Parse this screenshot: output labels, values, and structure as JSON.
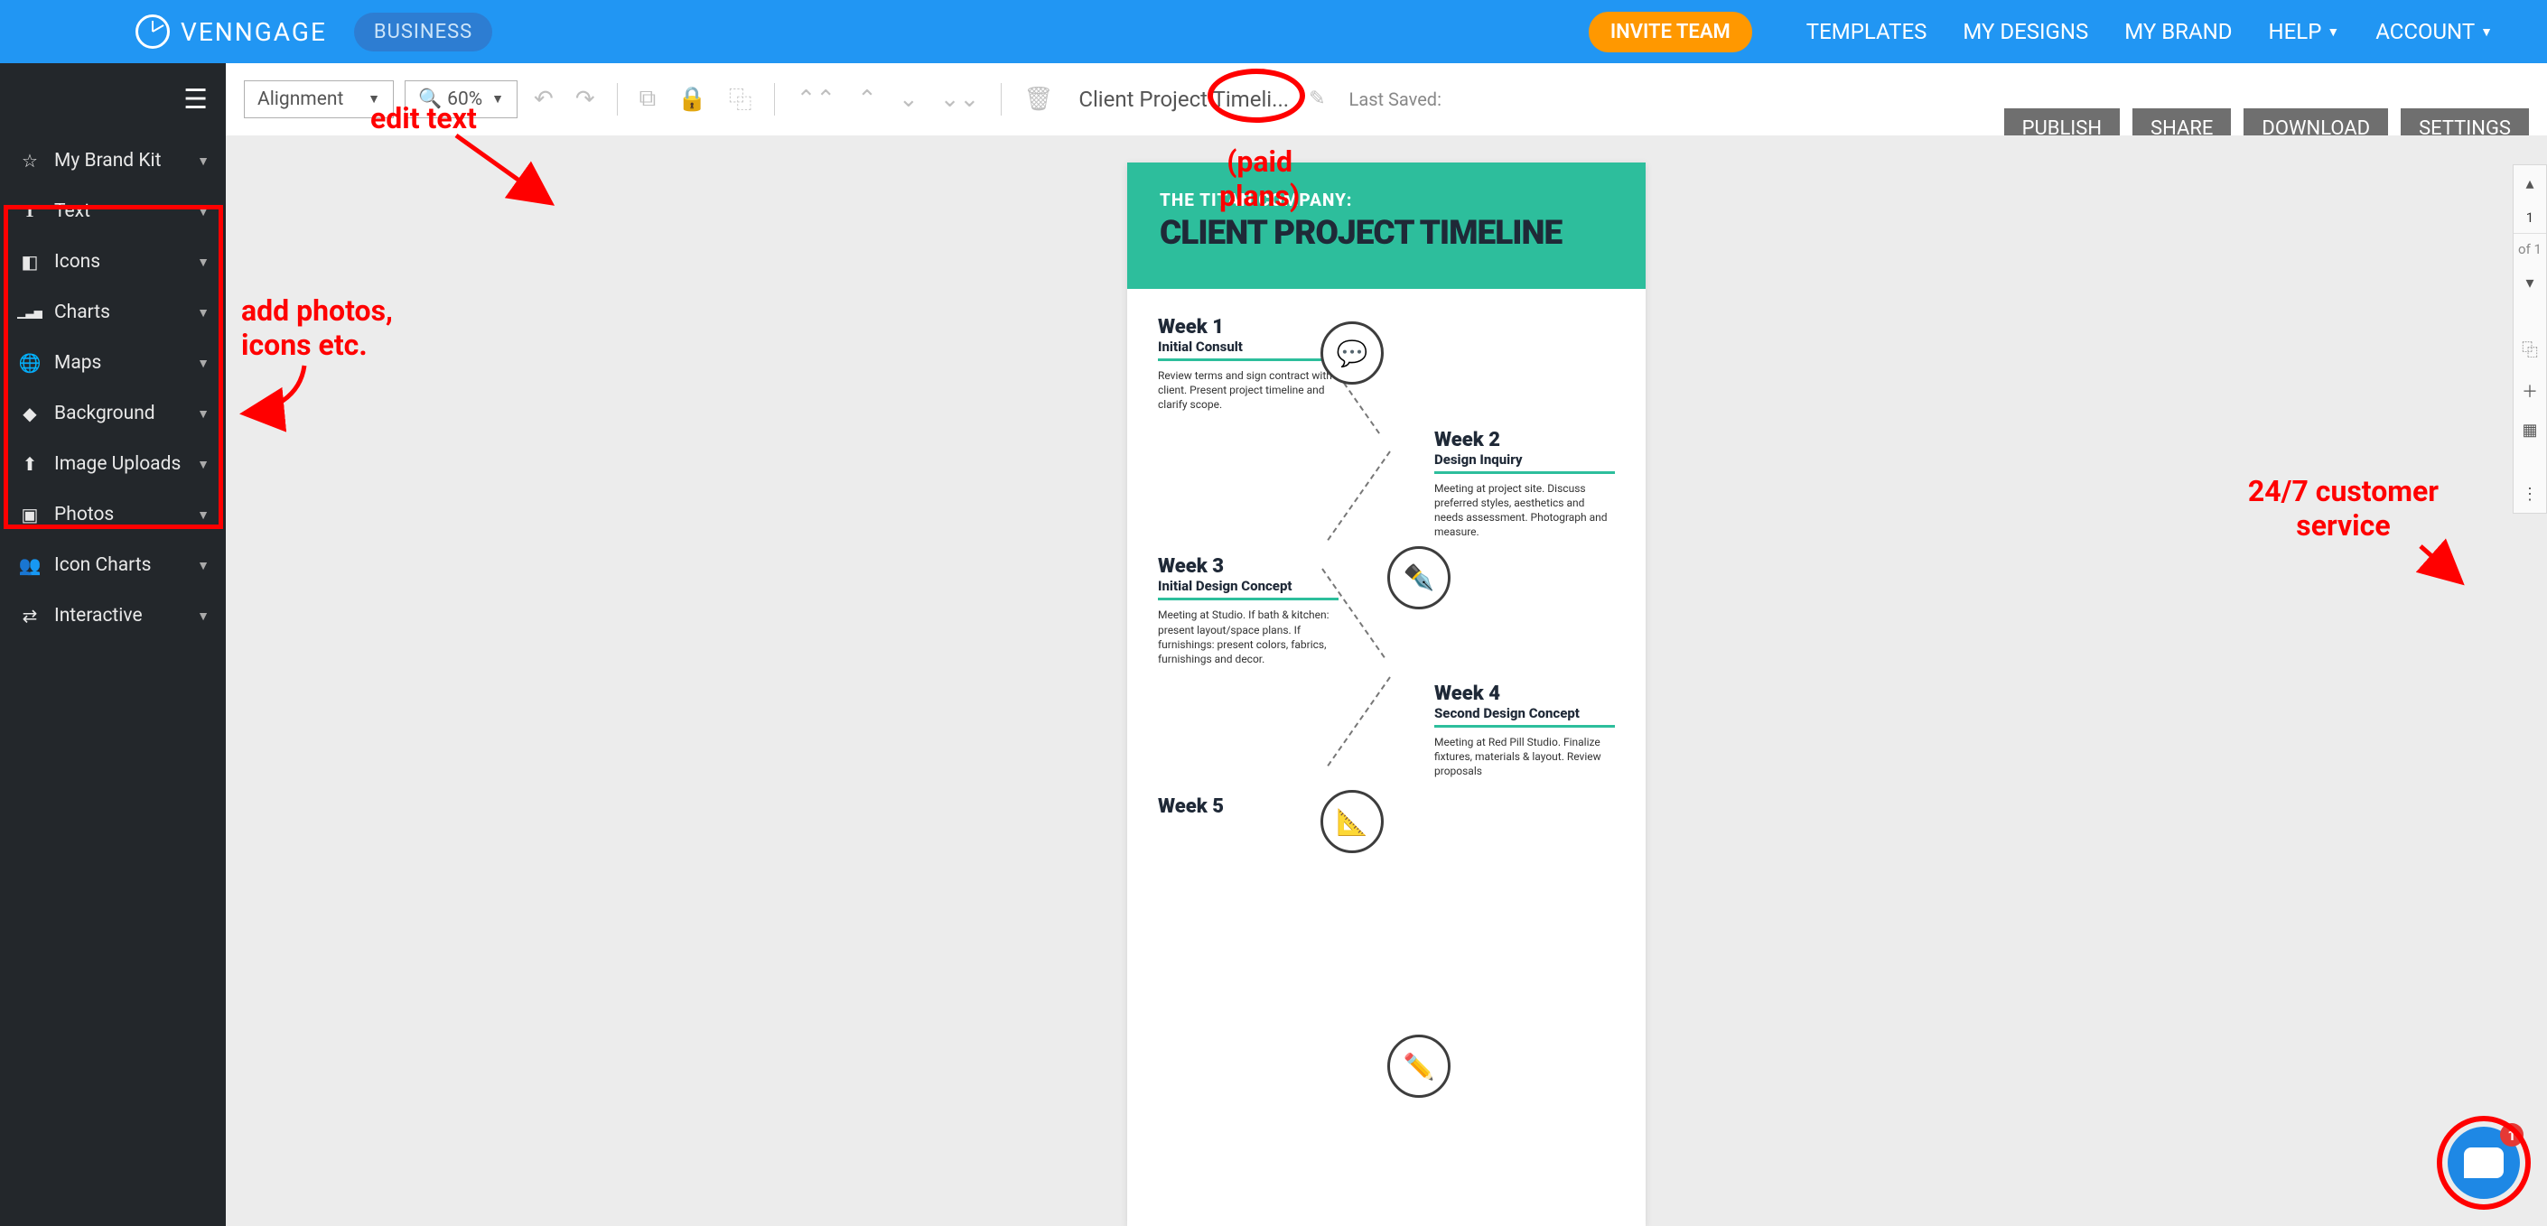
{
  "header": {
    "brand": "VENNGAGE",
    "plan_badge": "BUSINESS",
    "invite_label": "INVITE TEAM",
    "nav": [
      "TEMPLATES",
      "MY DESIGNS",
      "MY BRAND",
      "HELP",
      "ACCOUNT"
    ]
  },
  "sidebar": {
    "items": [
      {
        "label": "My Brand Kit",
        "icon": "☆"
      },
      {
        "label": "Text",
        "icon": "T"
      },
      {
        "label": "Icons",
        "icon": "◧"
      },
      {
        "label": "Charts",
        "icon": "▁▃▅"
      },
      {
        "label": "Maps",
        "icon": "🌐"
      },
      {
        "label": "Background",
        "icon": "◆"
      },
      {
        "label": "Image Uploads",
        "icon": "⬆"
      },
      {
        "label": "Photos",
        "icon": "▣"
      },
      {
        "label": "Icon Charts",
        "icon": "👥"
      },
      {
        "label": "Interactive",
        "icon": "⇄"
      }
    ]
  },
  "toolbar": {
    "alignment_label": "Alignment",
    "zoom_label": "60%",
    "doc_title": "Client Project Timeli...",
    "last_saved": "Last Saved:",
    "buttons": {
      "publish": "PUBLISH",
      "share": "SHARE",
      "download": "DOWNLOAD",
      "settings": "SETTINGS"
    }
  },
  "rail": {
    "page_current": "1",
    "page_total": "of 1"
  },
  "canvas": {
    "subtitle": "THE TITAN COMPANY:",
    "title": "CLIENT PROJECT TIMELINE",
    "weeks": [
      {
        "title": "Week 1",
        "sub": "Initial Consult",
        "body": "Review terms and sign contract with client. Present project timeline and clarify scope."
      },
      {
        "title": "Week 2",
        "sub": "Design Inquiry",
        "body": "Meeting at project site. Discuss preferred styles, aesthetics and needs assessment. Photograph and measure."
      },
      {
        "title": "Week 3",
        "sub": "Initial Design Concept",
        "body": "Meeting at Studio. If bath & kitchen: present layout/space plans. If furnishings: present colors, fabrics, furnishings and decor."
      },
      {
        "title": "Week 4",
        "sub": "Second Design Concept",
        "body": "Meeting at Red Pill Studio. Finalize fixtures, materials & layout. Review proposals"
      },
      {
        "title": "Week 5",
        "sub": "",
        "body": ""
      }
    ]
  },
  "annotations": {
    "edit_text": "edit text",
    "add_photos_l1": "add photos,",
    "add_photos_l2": "icons etc.",
    "paid_plans_l1": "(paid",
    "paid_plans_l2": "plans)",
    "customer_l1": "24/7 customer",
    "customer_l2": "service"
  },
  "chat": {
    "badge": "1"
  }
}
